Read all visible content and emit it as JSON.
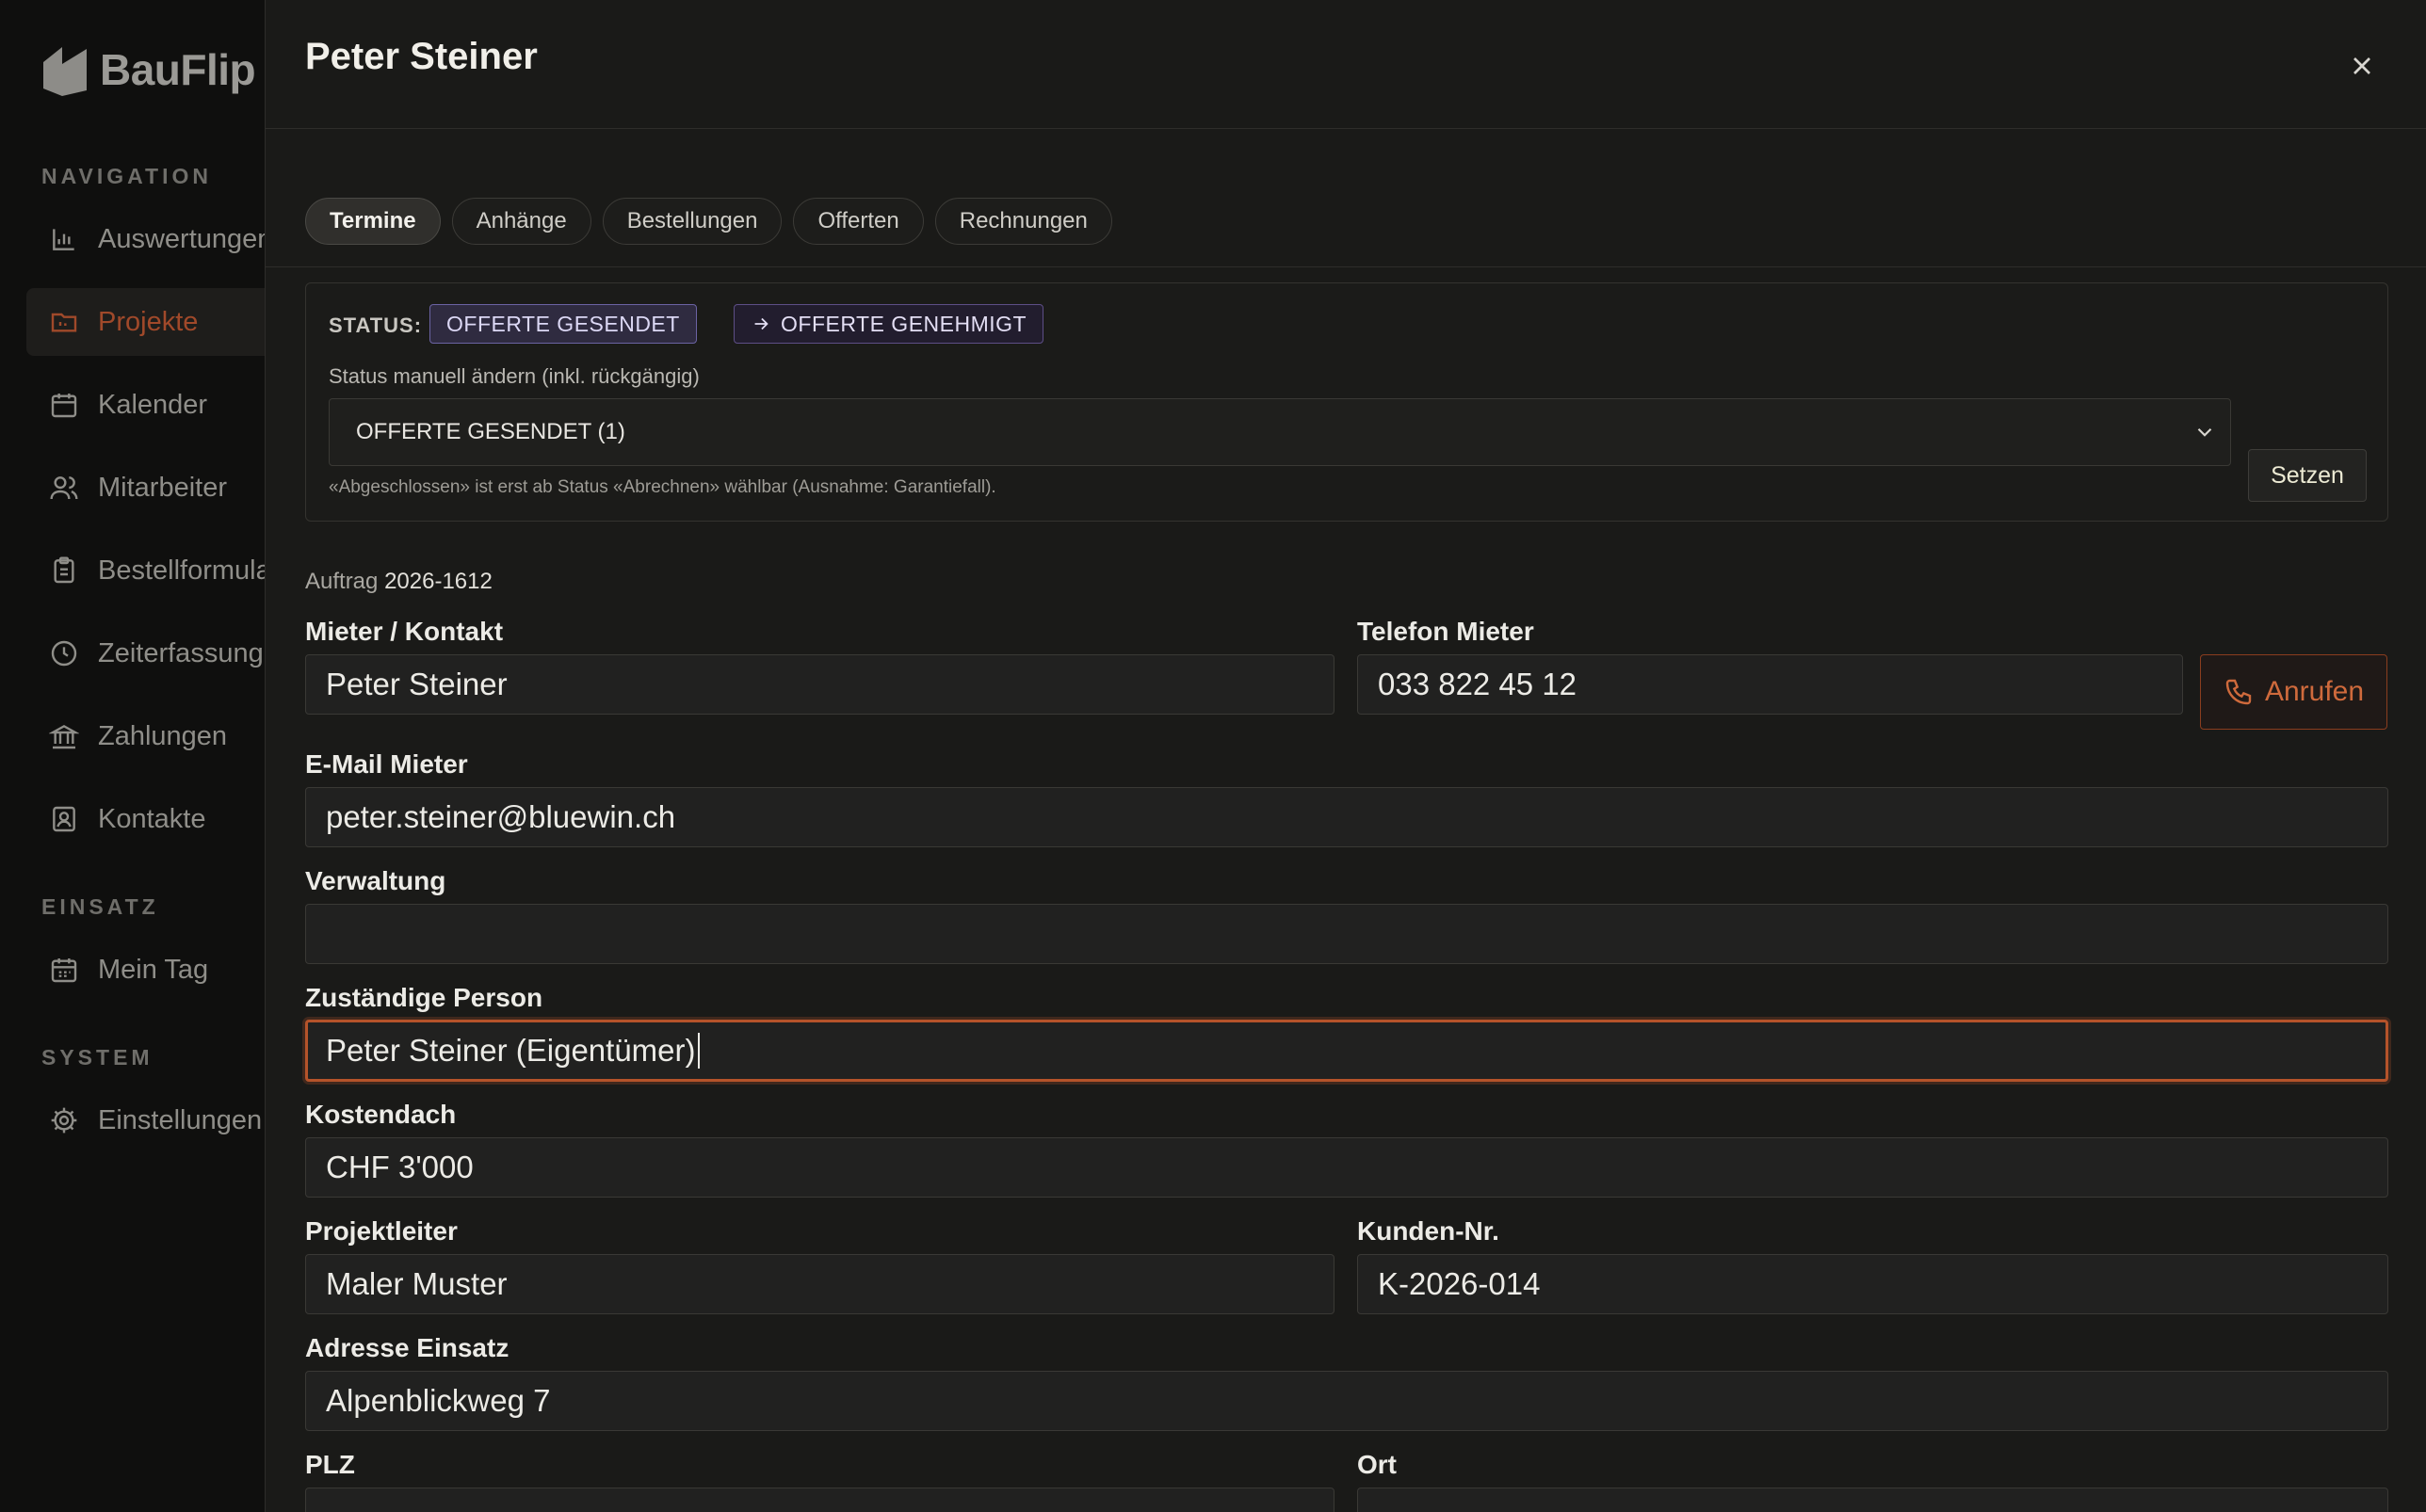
{
  "brand": {
    "name": "BauFlip"
  },
  "sidebar": {
    "sections": {
      "navigation": "NAVIGATION",
      "einsatz": "EINSATZ",
      "system": "SYSTEM"
    },
    "items": [
      {
        "label": "Auswertungen",
        "icon": "bar-chart-icon"
      },
      {
        "label": "Projekte",
        "icon": "folder-icon",
        "active": true
      },
      {
        "label": "Kalender",
        "icon": "calendar-icon"
      },
      {
        "label": "Mitarbeiter",
        "icon": "users-icon"
      },
      {
        "label": "Bestellformular",
        "icon": "clipboard-icon"
      },
      {
        "label": "Zeiterfassung",
        "icon": "clock-icon"
      },
      {
        "label": "Zahlungen",
        "icon": "bank-icon"
      },
      {
        "label": "Kontakte",
        "icon": "contact-icon"
      },
      {
        "label": "Mein Tag",
        "icon": "calendar-day-icon"
      },
      {
        "label": "Einstellungen",
        "icon": "gear-icon"
      }
    ]
  },
  "modal": {
    "title": "Peter Steiner",
    "tabs": [
      {
        "label": "Termine",
        "active": true
      },
      {
        "label": "Anhänge"
      },
      {
        "label": "Bestellungen"
      },
      {
        "label": "Offerten"
      },
      {
        "label": "Rechnungen"
      }
    ],
    "status": {
      "label": "STATUS:",
      "current": "OFFERTE GESENDET",
      "next": "OFFERTE GENEHMIGT",
      "manual_label": "Status manuell ändern (inkl. rückgängig)",
      "select_value": "OFFERTE GESENDET (1)",
      "hint": "«Abgeschlossen» ist erst ab Status «Abrechnen» wählbar (Ausnahme: Garantiefall).",
      "set_button": "Setzen"
    },
    "order": {
      "prefix": "Auftrag",
      "number": "2026-1612"
    },
    "form": {
      "mieter": {
        "label": "Mieter / Kontakt",
        "value": "Peter Steiner"
      },
      "telefon": {
        "label": "Telefon Mieter",
        "value": "033 822 45 12"
      },
      "call_button": "Anrufen",
      "email": {
        "label": "E-Mail Mieter",
        "value": "peter.steiner@bluewin.ch"
      },
      "verwaltung": {
        "label": "Verwaltung",
        "value": ""
      },
      "zustaendig": {
        "label": "Zuständige Person",
        "value": "Peter Steiner (Eigentümer)"
      },
      "kostendach": {
        "label": "Kostendach",
        "value": "CHF 3'000"
      },
      "projektleiter": {
        "label": "Projektleiter",
        "value": "Maler Muster"
      },
      "kunden_nr": {
        "label": "Kunden-Nr.",
        "value": "K-2026-014"
      },
      "adresse": {
        "label": "Adresse Einsatz",
        "value": "Alpenblickweg 7"
      },
      "plz": {
        "label": "PLZ",
        "value": ""
      },
      "ort": {
        "label": "Ort",
        "value": ""
      }
    }
  },
  "colors": {
    "accent": "#b5532a",
    "status_purple": "#6b63a3",
    "background": "#1a1a18"
  }
}
